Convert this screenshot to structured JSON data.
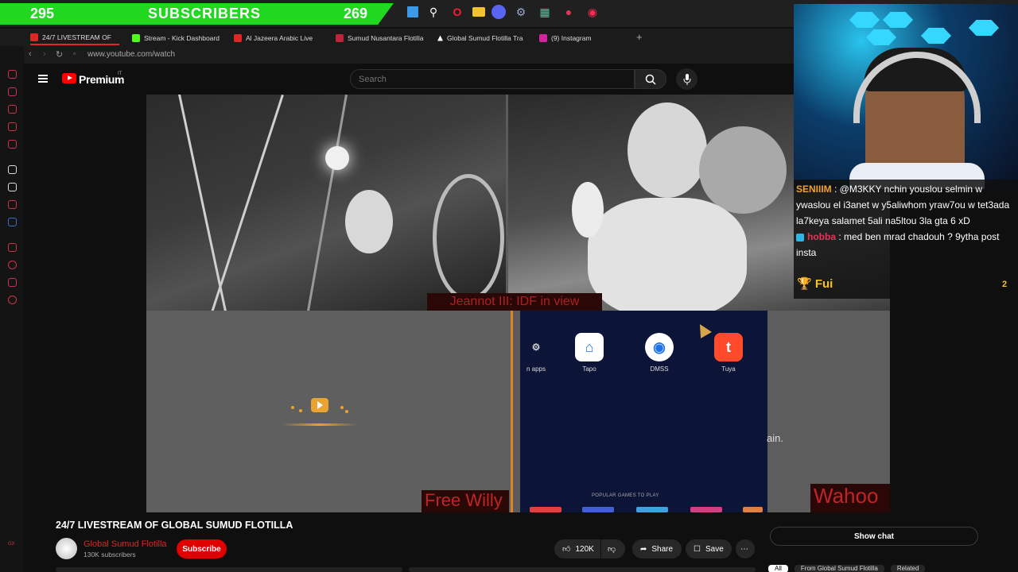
{
  "overlay": {
    "left_count": "295",
    "label": "SUBSCRIBERS",
    "right_count": "269"
  },
  "tabs": [
    {
      "label": "24/7 LIVESTREAM OF",
      "color": "#e02525"
    },
    {
      "label": "Stream - Kick Dashboard",
      "color": "#53fc18"
    },
    {
      "label": "Al Jazeera Arabic Live",
      "color": "#e02525"
    },
    {
      "label": "Sumud Nusantara Flotilla",
      "color": "#c0243a"
    },
    {
      "label": "Global Sumud Flotilla Tra",
      "color": "#ffffff"
    },
    {
      "label": "(9) Instagram",
      "color": "#d6249f"
    }
  ],
  "address": {
    "url": "www.youtube.com/watch"
  },
  "youtube": {
    "brand": "Premium",
    "region": "IT",
    "search_placeholder": "Search"
  },
  "video": {
    "cam_caption": "Jeannot III: IDF in view",
    "sticker_left": "Free Willy",
    "sticker_right": "Wahoo",
    "apps": [
      {
        "label": "n apps"
      },
      {
        "label": "Tapo"
      },
      {
        "label": "DMSS"
      },
      {
        "label": "Tuya"
      }
    ],
    "popular_label": "POPULAR GAMES TO PLAY",
    "partial_text": "ain."
  },
  "chat": {
    "messages": [
      {
        "user": "SENIIIM",
        "text": ": @M3KKY nchin youslou selmin w ywaslou el i3anet w y5aliwhom yraw7ou w tet3ada la7keya salamet 5ali na5ltou 3la gta 6 xD",
        "user_color": "#f0a22b"
      },
      {
        "user": "hobba",
        "text": ": med ben mrad chadouh ? 9ytha post insta",
        "user_color": "#e0365a"
      }
    ],
    "pinned_label": "Fui",
    "pinned_count": "2"
  },
  "meta": {
    "title": "24/7 LIVESTREAM OF GLOBAL SUMUD FLOTILLA",
    "channel": "Global Sumud Flotilla",
    "subscribers": "130K subscribers",
    "subscribe_label": "Subscribe",
    "likes": "120K",
    "share_label": "Share",
    "save_label": "Save",
    "show_chat_label": "Show chat",
    "chips": [
      "All",
      "From Global Sumud Flotilla",
      "Related"
    ]
  }
}
